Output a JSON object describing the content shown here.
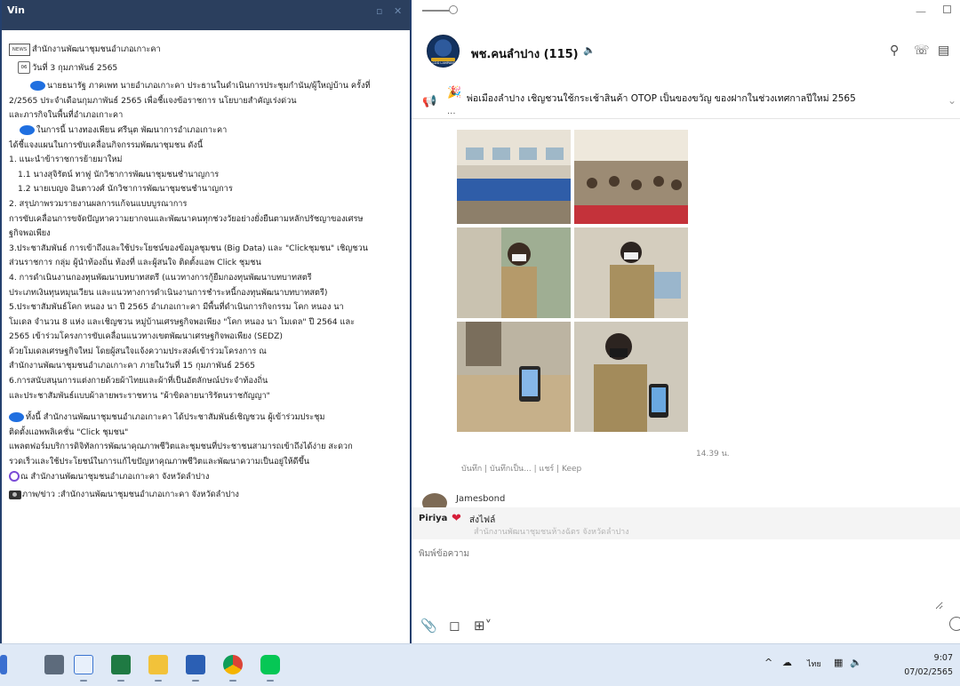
{
  "left_window": {
    "title": "Vin",
    "news_icon_text": "NEWS",
    "calendar_icon_text": "06",
    "lines": [
      "สำนักงานพัฒนาชุมชนอำเภอเกาะคา",
      "วันที่ 3 กุมภาพันธ์ 2565",
      "นายธนารัฐ ภาคเพท นายอำเภอเกาะคา ประธานในดำเนินการประชุมกำนัน/ผู้ใหญ่บ้าน ครั้งที่",
      "2/2565 ประจำเดือนกุมภาพันธ์ 2565 เพื่อชี้แจงข้อราชการ นโยบายสำคัญเร่งด่วน",
      "และภารกิจในพื้นที่อำเภอเกาะคา",
      "ในการนี้ นางทองเพียน ศรีนุต พัฒนาการอำเภอเกาะคา",
      "ได้ชี้แจงแผนในการขับเคลื่อนกิจกรรมพัฒนาชุมชน ดังนี้",
      "1. แนะนำข้าราชการย้ายมาใหม่",
      "1.1 นางสุจิรัตน์ ทาฟู  นักวิชาการพัฒนาชุมชนชำนาญการ",
      "1.2 นายเบญจ อินตาวงศ์  นักวิชาการพัฒนาชุมชนชำนาญการ",
      "2. สรุปภาพรวมรายงานผลการแก้จนแบบบูรณาการ",
      "การขับเคลื่อนการขจัดปัญหาความยากจนและพัฒนาคนทุกช่วงวัยอย่างยั่งยืนตามหลักปรัชญาของเศรษ",
      "ฐกิจพอเพียง",
      "3.ประชาสัมพันธ์ การเข้าถึงและใช้ประโยชน์ของข้อมูลชุมชน (Big Data) และ \"Clickชุมชน\" เชิญชวน",
      "ส่วนราชการ กลุ่ม ผู้นำท้องถิ่น ท้องที่ และผู้สนใจ ติดตั้งแอพ  Click ชุมชน",
      "4. การดำเนินงานกองทุนพัฒนาบทบาทสตรี (แนวทางการกู้ยืมกองทุนพัฒนาบทบาทสตรี",
      "ประเภทเงินทุนหมุนเวียน และแนวทางการดำเนินงานการชำระหนี้กองทุนพัฒนาบทบาทสตรี)",
      "5.ประชาสัมพันธ์โคก หนอง นา ปี 2565  อำเภอเกาะคา มีพื้นที่ดำเนินการกิจกรรม โคก หนอง นา",
      "โมเดล จำนวน  8  แห่ง และเชิญชวน หมู่บ้านเศรษฐกิจพอเพียง \"โคก หนอง นา โมเดล\" ปี 2564 และ",
      "2565  เข้าร่วมโครงการขับเคลื่อนแนวทางเขตพัฒนาเศรษฐกิจพอเพียง (SEDZ)",
      "ด้วยโมเดลเศรษฐกิจใหม่  โดยผู้สนใจแจ้งความประสงค์เข้าร่วมโครงการ ณ",
      "สำนักงานพัฒนาชุมชนอำเภอเกาะคา ภายในวันที่  15  กุมภาพันธ์  2565",
      "6.การสนับสนุนการแต่งกายด้วยผ้าไทยและผ้าที่เป็นอัตลักษณ์ประจำท้องถิ่น",
      "และประชาสัมพันธ์แบบผ้าลายพระราชทาน \"ผ้าขิดลายนาริรัตนราชกัญญา\"",
      "ทั้งนี้ สำนักงานพัฒนาชุมชนอำเภอเกาะคา ได้ประชาสัมพันธ์เชิญชวน ผู้เข้าร่วมประชุม",
      "ติดตั้งแอพพลิเคชั่น \"Click ชุมชน\"",
      "แพลตฟอร์มบริการดิจิทัลการพัฒนาคุณภาพชีวิตและชุมชนที่ประชาชนสามารถเข้าถึงได้ง่าย สะดวก",
      "รวดเร็วและใช้ประโยชน์ในการแก้ไขปัญหาคุณภาพชีวิตและพัฒนาความเป็นอยู่ให้ดีขึ้น",
      "ณ สำนักงานพัฒนาชุมชนอำเภอเกาะคา จังหวัดลำปาง",
      "ภาพ/ข่าว :สำนักงานพัฒนาชุมชนอำเภอเกาะคา จังหวัดลำปาง"
    ]
  },
  "chat": {
    "group_name": "พช.คนลำปาง (115)",
    "avatar_label": "CDD LAMPANG",
    "announcement": "พ่อเมืองลำปาง เชิญชวนใช้กระเช้าสินค้า OTOP เป็นของขวัญ ของฝากในช่วงเทศกาลปีใหม่ 2565",
    "announcement_more": "...",
    "message_time": "14.39 น.",
    "message_actions": "บันทึก | บันทึกเป็น... | แชร์ | Keep",
    "sender_name": "Jamesbond",
    "reaction_user": "Piriya",
    "reaction_label": "ส่งไฟล์",
    "reaction_sub": "สำนักงานพัฒนาชุมชนห้างฉัตร จังหวัดลำปาง",
    "input_placeholder": "พิมพ์ข้อความ"
  },
  "taskbar": {
    "lang": "ไทย",
    "time": "9:07",
    "date": "07/02/2565"
  },
  "colors": {
    "title_bar": "#2b3f5e",
    "accent_blue": "#1f6fe0",
    "taskbar": "#dfe9f6",
    "heart": "#d61f3a"
  }
}
